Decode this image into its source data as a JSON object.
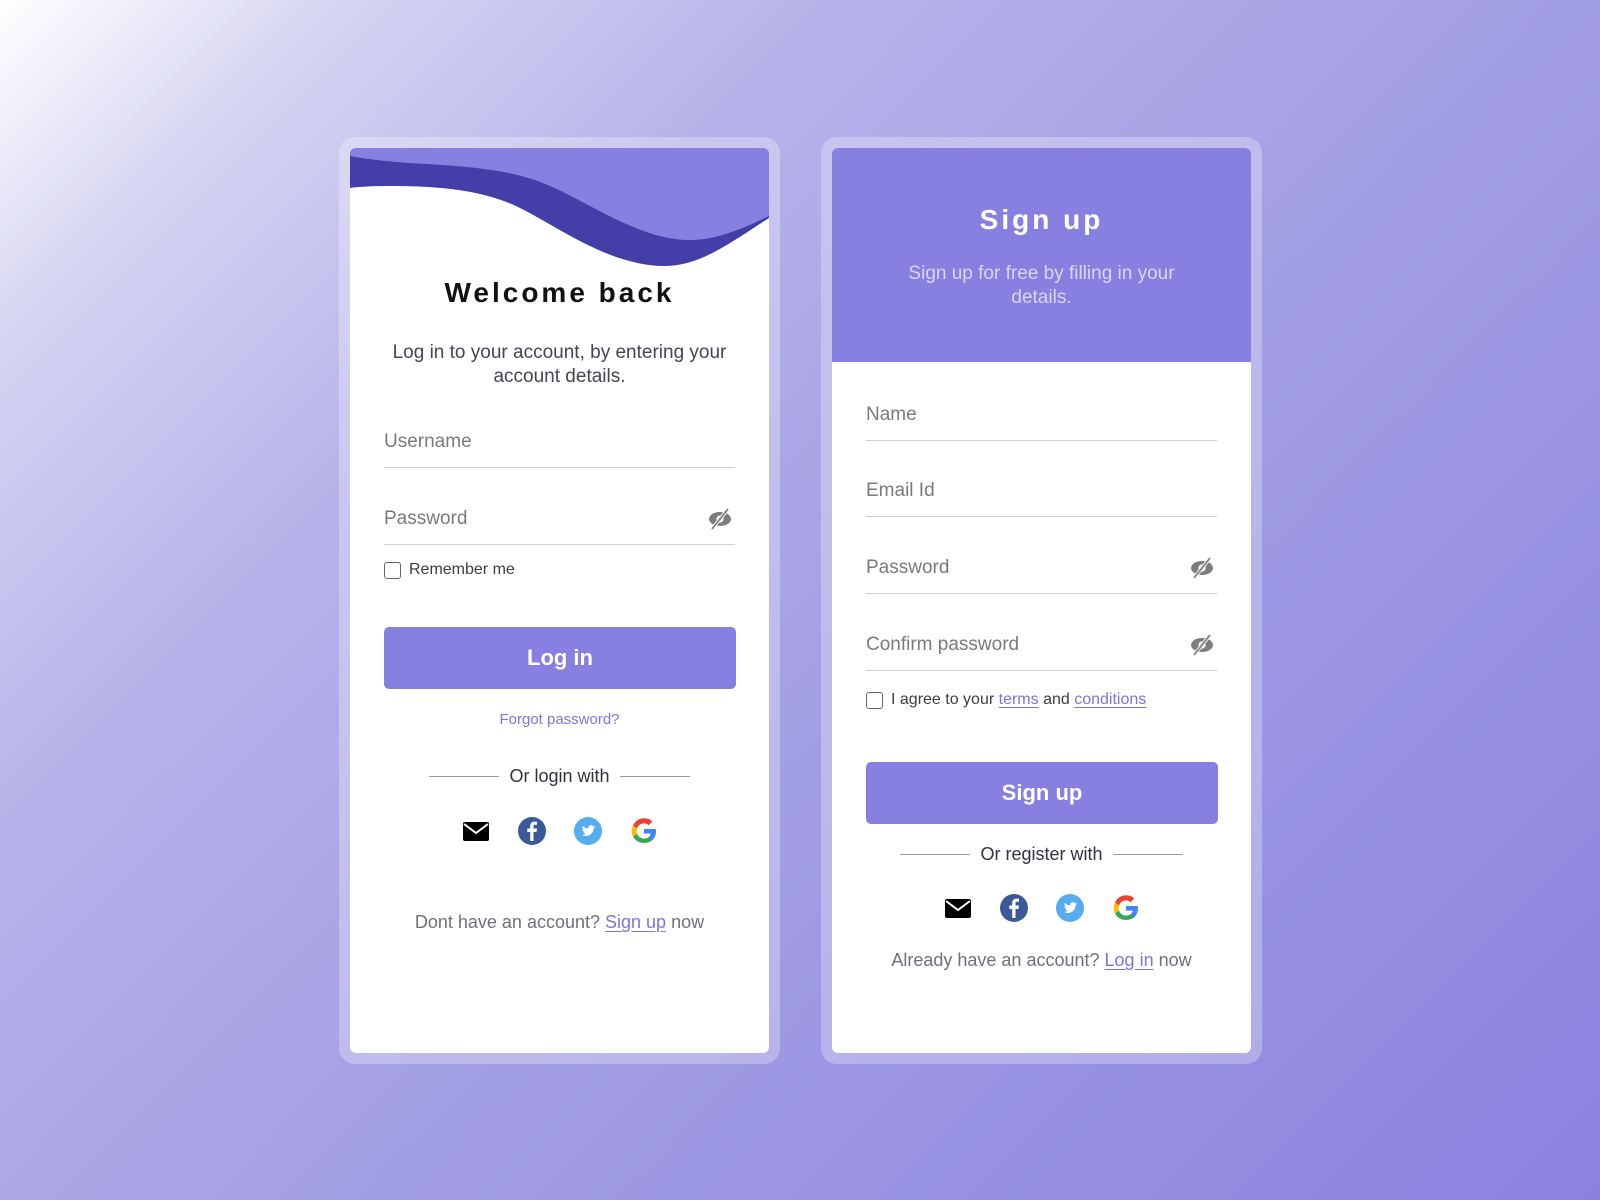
{
  "login": {
    "title": "Welcome back",
    "subtitle": "Log in to your account, by entering your account details.",
    "username_placeholder": "Username",
    "password_placeholder": "Password",
    "remember_label": "Remember me",
    "login_button": "Log in",
    "forgot_link": "Forgot password?",
    "divider_text": "Or login with",
    "footer_prefix": "Dont have an account?",
    "footer_link": "Sign up",
    "footer_suffix": "now"
  },
  "signup": {
    "title": "Sign up",
    "subtitle": "Sign up for free by filling in your details.",
    "name_placeholder": "Name",
    "email_placeholder": "Email Id",
    "password_placeholder": "Password",
    "confirm_placeholder": "Confirm password",
    "agree_prefix": "I agree to your",
    "terms_link": "terms",
    "agree_and": "and",
    "conditions_link": "conditions",
    "signup_button": "Sign up",
    "divider_text": "Or register with",
    "footer_prefix": "Already have an account?",
    "footer_link": "Log in",
    "footer_suffix": "now"
  },
  "social_icons": [
    "email-icon",
    "facebook-icon",
    "twitter-icon",
    "google-icon"
  ],
  "colors": {
    "accent": "#8780e0",
    "accent_dark": "#443ea8",
    "link": "#7c74e0",
    "facebook": "#3b5998",
    "twitter": "#55acee"
  }
}
